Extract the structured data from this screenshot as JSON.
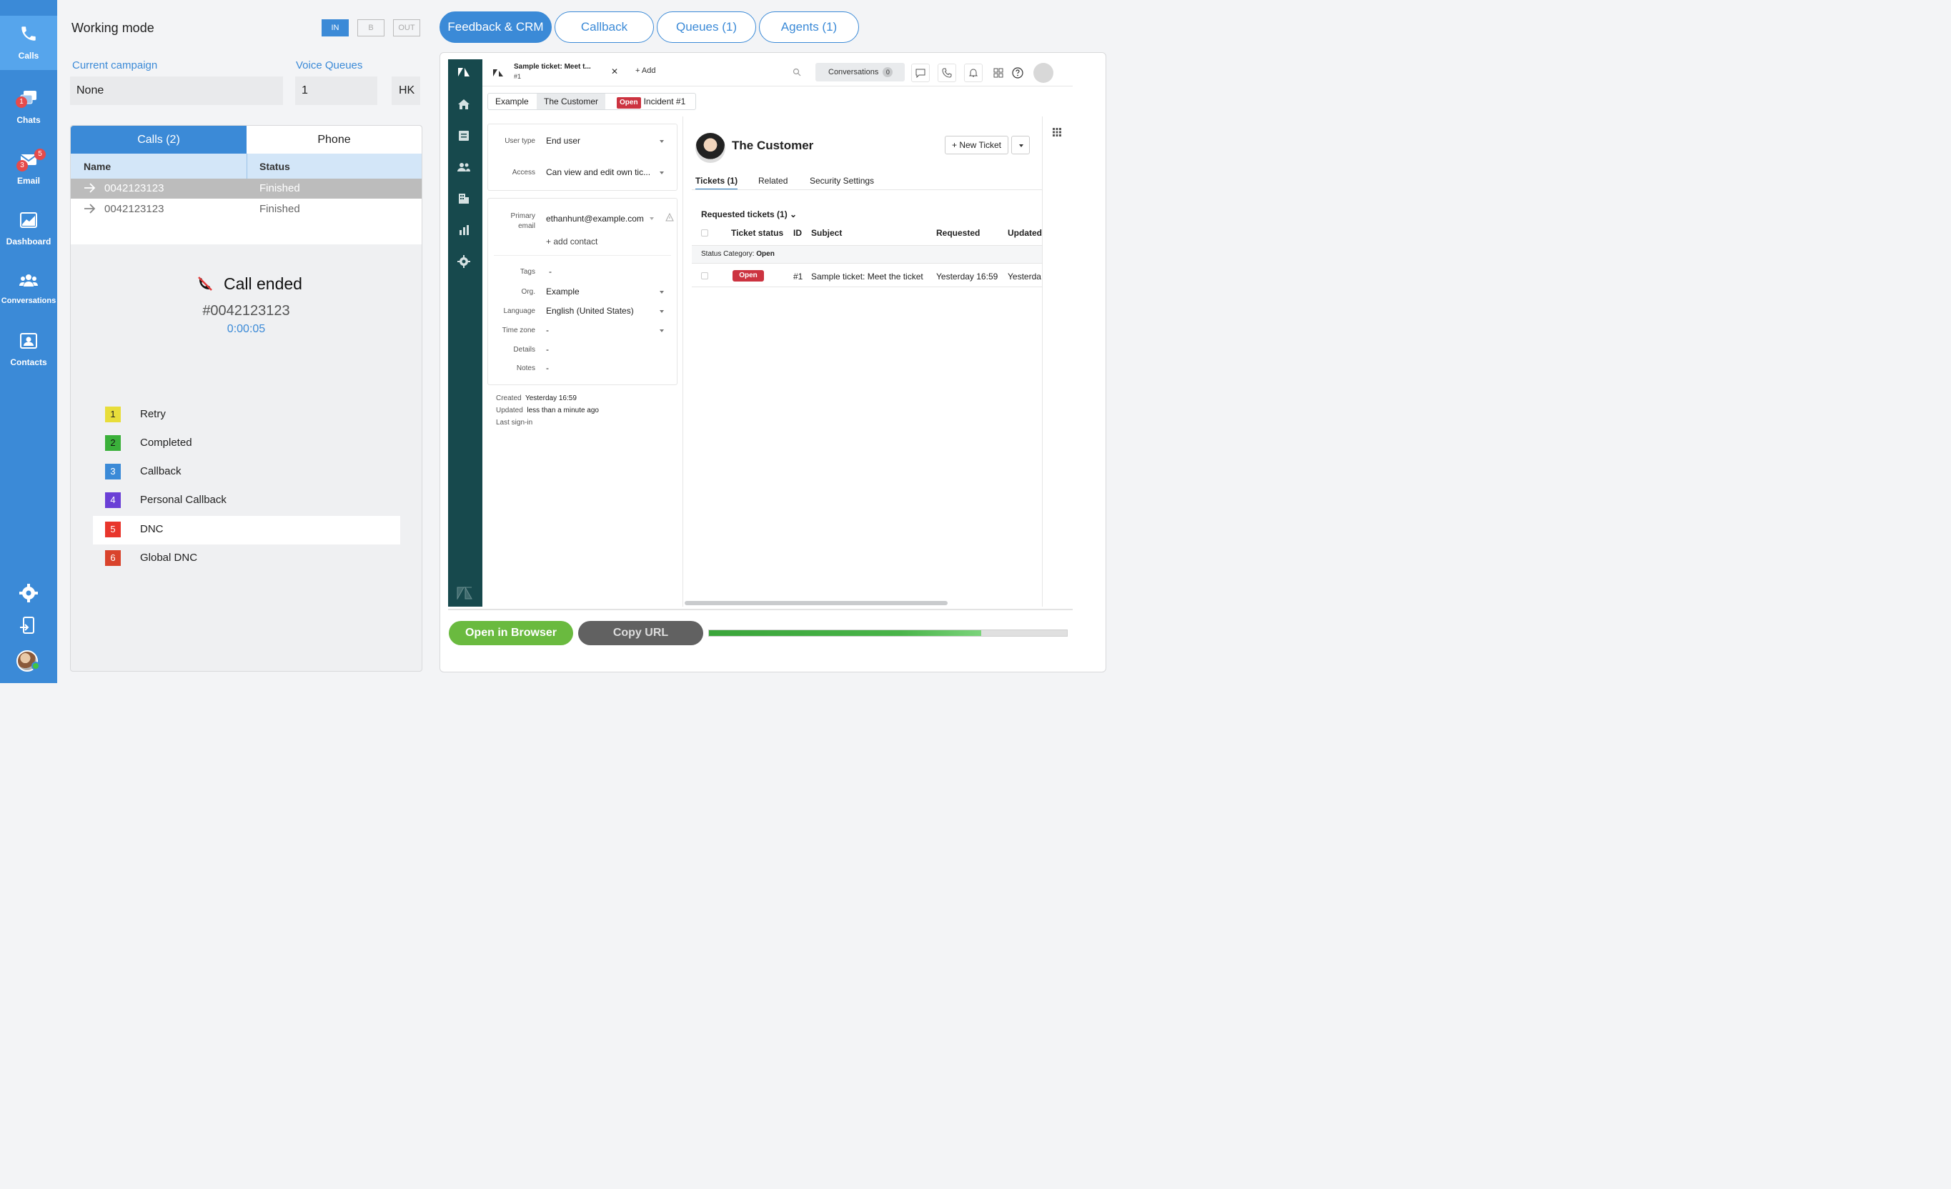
{
  "nav": {
    "items": [
      {
        "label": "Calls",
        "icon": "phone-icon"
      },
      {
        "label": "Chats",
        "icon": "chat-icon",
        "badge": "1"
      },
      {
        "label": "Email",
        "icon": "email-icon",
        "badge": "5",
        "badge2": "3"
      },
      {
        "label": "Dashboard",
        "icon": "dashboard-icon"
      },
      {
        "label": "Conversations",
        "icon": "conversations-icon"
      },
      {
        "label": "Contacts",
        "icon": "contacts-icon"
      }
    ]
  },
  "left": {
    "working_mode": "Working mode",
    "modes": [
      "IN",
      "B",
      "OUT"
    ],
    "current_campaign_label": "Current campaign",
    "current_campaign": "None",
    "voice_queues_label": "Voice Queues",
    "voice_queues_value": "1",
    "voice_queues_unit": "HK",
    "tabs": [
      "Calls (2)",
      "Phone"
    ],
    "table": {
      "headers": [
        "Name",
        "Status"
      ],
      "rows": [
        {
          "name": "0042123123",
          "status": "Finished"
        },
        {
          "name": "0042123123",
          "status": "Finished"
        }
      ]
    },
    "call": {
      "title": "Call ended",
      "number": "#0042123123",
      "duration": "0:00:05"
    },
    "dispositions": [
      {
        "key": "1",
        "label": "Retry",
        "color": "#e8dd3a"
      },
      {
        "key": "2",
        "label": "Completed",
        "color": "#3ab03a"
      },
      {
        "key": "3",
        "label": "Callback",
        "color": "#3b8ad7"
      },
      {
        "key": "4",
        "label": "Personal Callback",
        "color": "#6a3fd6"
      },
      {
        "key": "5",
        "label": "DNC",
        "color": "#e8362c"
      },
      {
        "key": "6",
        "label": "Global DNC",
        "color": "#d9432c"
      }
    ]
  },
  "top_tabs": [
    "Feedback & CRM",
    "Callback",
    "Queues (1)",
    "Agents (1)"
  ],
  "zd": {
    "tab_title": "Sample ticket: Meet t...",
    "tab_sub": "#1",
    "add": "+ Add",
    "conversations": "Conversations",
    "conversations_count": "0",
    "crumbs": [
      "Example",
      "The Customer",
      "Incident #1"
    ],
    "open_label": "Open",
    "props": {
      "user_type_label": "User type",
      "user_type": "End user",
      "access_label": "Access",
      "access": "Can view and edit own tic...",
      "primary_label": "Primary",
      "email_label": "email",
      "email": "ethanhunt@example.com",
      "add_contact": "+ add contact",
      "tags_label": "Tags",
      "tags": "-",
      "org_label": "Org.",
      "org": "Example",
      "language_label": "Language",
      "language": "English (United States)",
      "timezone_label": "Time zone",
      "timezone": "-",
      "details_label": "Details",
      "details": "-",
      "notes_label": "Notes",
      "notes": "-"
    },
    "meta": {
      "created_label": "Created",
      "created": "Yesterday 16:59",
      "updated_label": "Updated",
      "updated": "less than a minute ago",
      "last_signin_label": "Last sign-in"
    },
    "customer_name": "The Customer",
    "new_ticket": "+ New Ticket",
    "subtabs": [
      "Tickets (1)",
      "Related",
      "Security Settings"
    ],
    "requested_tickets": "Requested tickets (1) ⌄",
    "columns": [
      "Ticket status",
      "ID",
      "Subject",
      "Requested",
      "Updated"
    ],
    "status_category_label": "Status Category:",
    "status_category": "Open",
    "ticket": {
      "status": "Open",
      "id": "#1",
      "subject": "Sample ticket: Meet the ticket",
      "requested": "Yesterday 16:59",
      "updated": "Yesterda"
    }
  },
  "bottom": {
    "open_browser": "Open in Browser",
    "copy_url": "Copy URL",
    "progress": 0.76
  }
}
